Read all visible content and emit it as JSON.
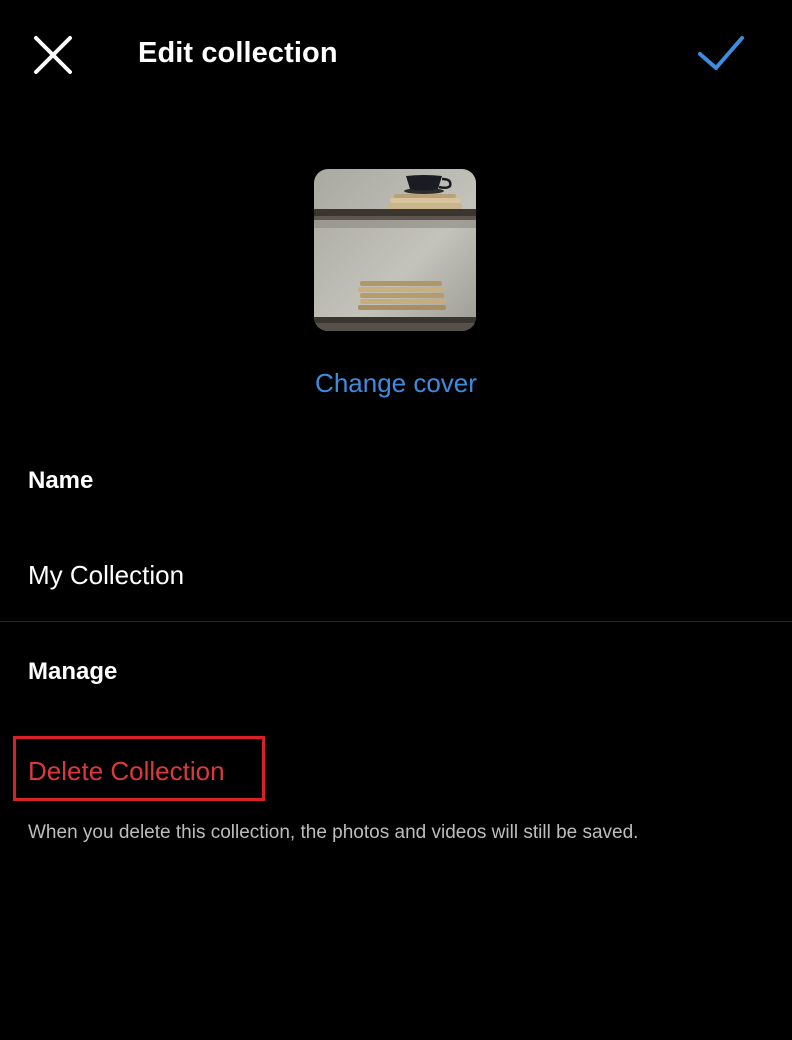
{
  "header": {
    "title": "Edit collection",
    "close_icon": "close-icon",
    "done_icon": "checkmark-icon"
  },
  "cover": {
    "image": "collection cover photo",
    "change_label": "Change cover"
  },
  "name_section": {
    "label": "Name",
    "value": "My Collection"
  },
  "manage_section": {
    "label": "Manage",
    "delete_label": "Delete Collection",
    "help_text": "When you delete this collection, the photos and videos will still be saved."
  },
  "colors": {
    "background": "#000000",
    "text": "#ffffff",
    "accent": "#3d8ce0",
    "destructive": "#d9393f",
    "highlight_box": "#d92027",
    "secondary_text": "#bdbdbd"
  }
}
